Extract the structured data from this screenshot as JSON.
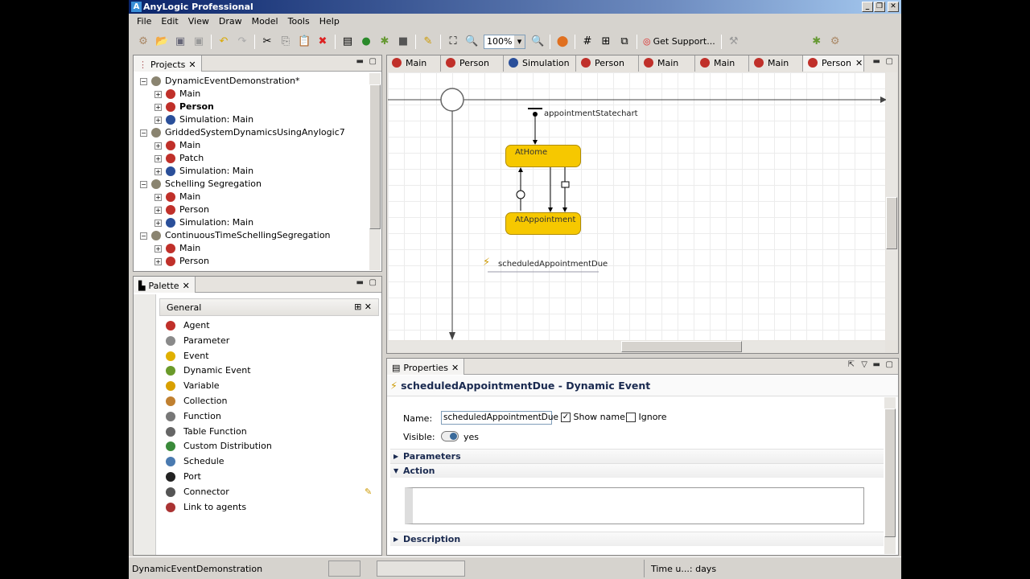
{
  "app": {
    "title": "AnyLogic Professional"
  },
  "menu": [
    "File",
    "Edit",
    "View",
    "Draw",
    "Model",
    "Tools",
    "Help"
  ],
  "toolbar": {
    "zoom": "100%",
    "support": "Get Support..."
  },
  "projects": {
    "tab": "Projects",
    "items": [
      {
        "label": "DynamicEventDemonstration*",
        "level": 0,
        "icon": "project"
      },
      {
        "label": "Main",
        "level": 1,
        "icon": "agent"
      },
      {
        "label": "Person",
        "level": 1,
        "icon": "agent",
        "bold": true
      },
      {
        "label": "Simulation: Main",
        "level": 1,
        "icon": "experiment"
      },
      {
        "label": "GriddedSystemDynamicsUsingAnylogic7",
        "level": 0,
        "icon": "project"
      },
      {
        "label": "Main",
        "level": 1,
        "icon": "agent"
      },
      {
        "label": "Patch",
        "level": 1,
        "icon": "agent"
      },
      {
        "label": "Simulation: Main",
        "level": 1,
        "icon": "experiment"
      },
      {
        "label": "Schelling Segregation",
        "level": 0,
        "icon": "project"
      },
      {
        "label": "Main",
        "level": 1,
        "icon": "agent"
      },
      {
        "label": "Person",
        "level": 1,
        "icon": "agent"
      },
      {
        "label": "Simulation: Main",
        "level": 1,
        "icon": "experiment"
      },
      {
        "label": "ContinuousTimeSchellingSegregation",
        "level": 0,
        "icon": "project"
      },
      {
        "label": "Main",
        "level": 1,
        "icon": "agent"
      },
      {
        "label": "Person",
        "level": 1,
        "icon": "agent"
      }
    ]
  },
  "palette": {
    "tab": "Palette",
    "section": "General",
    "items": [
      "Agent",
      "Parameter",
      "Event",
      "Dynamic Event",
      "Variable",
      "Collection",
      "Function",
      "Table Function",
      "Custom Distribution",
      "Schedule",
      "Port",
      "Connector",
      "Link to agents"
    ]
  },
  "editor": {
    "tabs": [
      "Main",
      "Person",
      "Simulation",
      "Person",
      "Main",
      "Main",
      "Main",
      "Person"
    ],
    "statechart": "appointmentStatechart",
    "states": [
      "AtHome",
      "AtAppointment"
    ],
    "event": "scheduledAppointmentDue"
  },
  "properties": {
    "tab": "Properties",
    "heading": "scheduledAppointmentDue - Dynamic Event",
    "name_label": "Name:",
    "name_value": "scheduledAppointmentDue",
    "show_name": "Show name",
    "show_name_checked": true,
    "ignore": "Ignore",
    "ignore_checked": false,
    "visible_label": "Visible:",
    "visible_value": "yes",
    "sections": [
      "Parameters",
      "Action",
      "Description"
    ]
  },
  "status": {
    "project": "DynamicEventDemonstration",
    "time_units": "Time u...: days"
  }
}
